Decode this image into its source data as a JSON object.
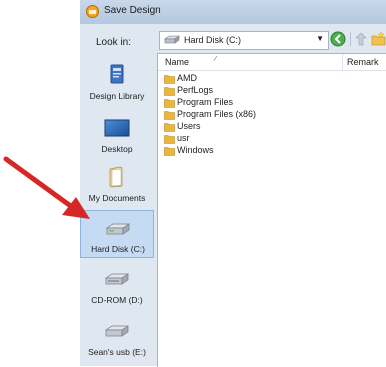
{
  "dialog": {
    "title": "Save Design"
  },
  "toolbar": {
    "look_in_label": "Look in:",
    "location": "Hard Disk (C:)"
  },
  "places": [
    {
      "label": "Design Library",
      "icon": "design-library-icon"
    },
    {
      "label": "Desktop",
      "icon": "desktop-icon"
    },
    {
      "label": "My Documents",
      "icon": "my-documents-icon"
    },
    {
      "label": "Hard Disk (C:)",
      "icon": "hard-disk-icon",
      "selected": true
    },
    {
      "label": "CD-ROM (D:)",
      "icon": "cd-rom-icon"
    },
    {
      "label": "Sean's usb (E:)",
      "icon": "usb-drive-icon"
    }
  ],
  "file_list": {
    "columns": [
      "Name",
      "Remark"
    ],
    "items": [
      "AMD",
      "PerfLogs",
      "Program Files",
      "Program Files (x86)",
      "Users",
      "usr",
      "Windows"
    ]
  },
  "colors": {
    "annotation_arrow": "#d62626",
    "folder": "#e8b73c",
    "selection": "#c5daf3"
  }
}
